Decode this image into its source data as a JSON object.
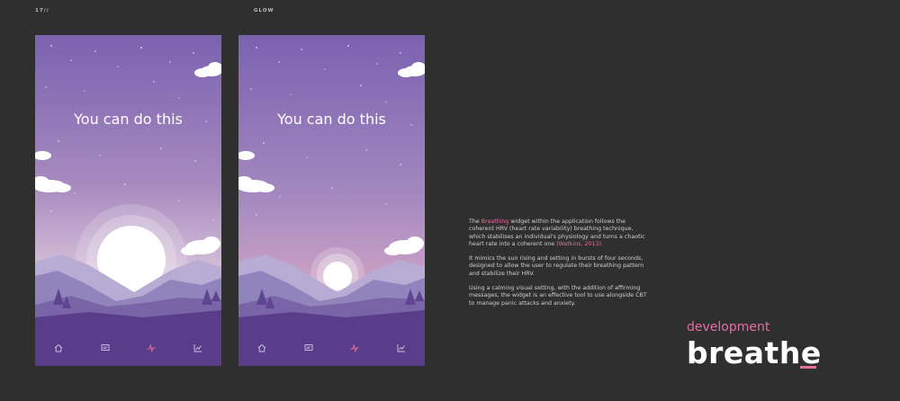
{
  "header": {
    "page_number": "17//",
    "brand": "GLOW"
  },
  "screens": [
    {
      "id": "screen-1",
      "message": "You can do this",
      "sun_size": "large"
    },
    {
      "id": "screen-2",
      "message": "You can do this",
      "sun_size": "small"
    }
  ],
  "tabbar": {
    "items": [
      {
        "name": "home-icon",
        "active": false
      },
      {
        "name": "chat-icon",
        "active": false
      },
      {
        "name": "pulse-icon",
        "active": true
      },
      {
        "name": "chart-icon",
        "active": false
      }
    ]
  },
  "description": {
    "p1_a": "The ",
    "p1_link": "Breathing",
    "p1_b": " widget within the application follows the coherent HRV (heart rate variability) breathing technique, which stabilises an individual's physiology and turns a chaotic heart rate into a coherent one ",
    "p1_cite": "(Watkins, 2013).",
    "p2": "It mimics the sun rising and setting in bursts of four seconds, designed to allow the user to regulate their breathing pattern and stabilize their HRV.",
    "p3": "Using a calming visual setting, with the addition of affirming messages, the widget is an effective tool to use alongside CBT to manage panic attacks and anxiety."
  },
  "section": {
    "label": "development",
    "title": "breathe"
  },
  "colors": {
    "background": "#2f2f2f",
    "accent": "#e56f9d",
    "sky_top": "#7a62b0",
    "sky_bottom": "#e2a8c2",
    "ground": "#5a3d8a"
  }
}
